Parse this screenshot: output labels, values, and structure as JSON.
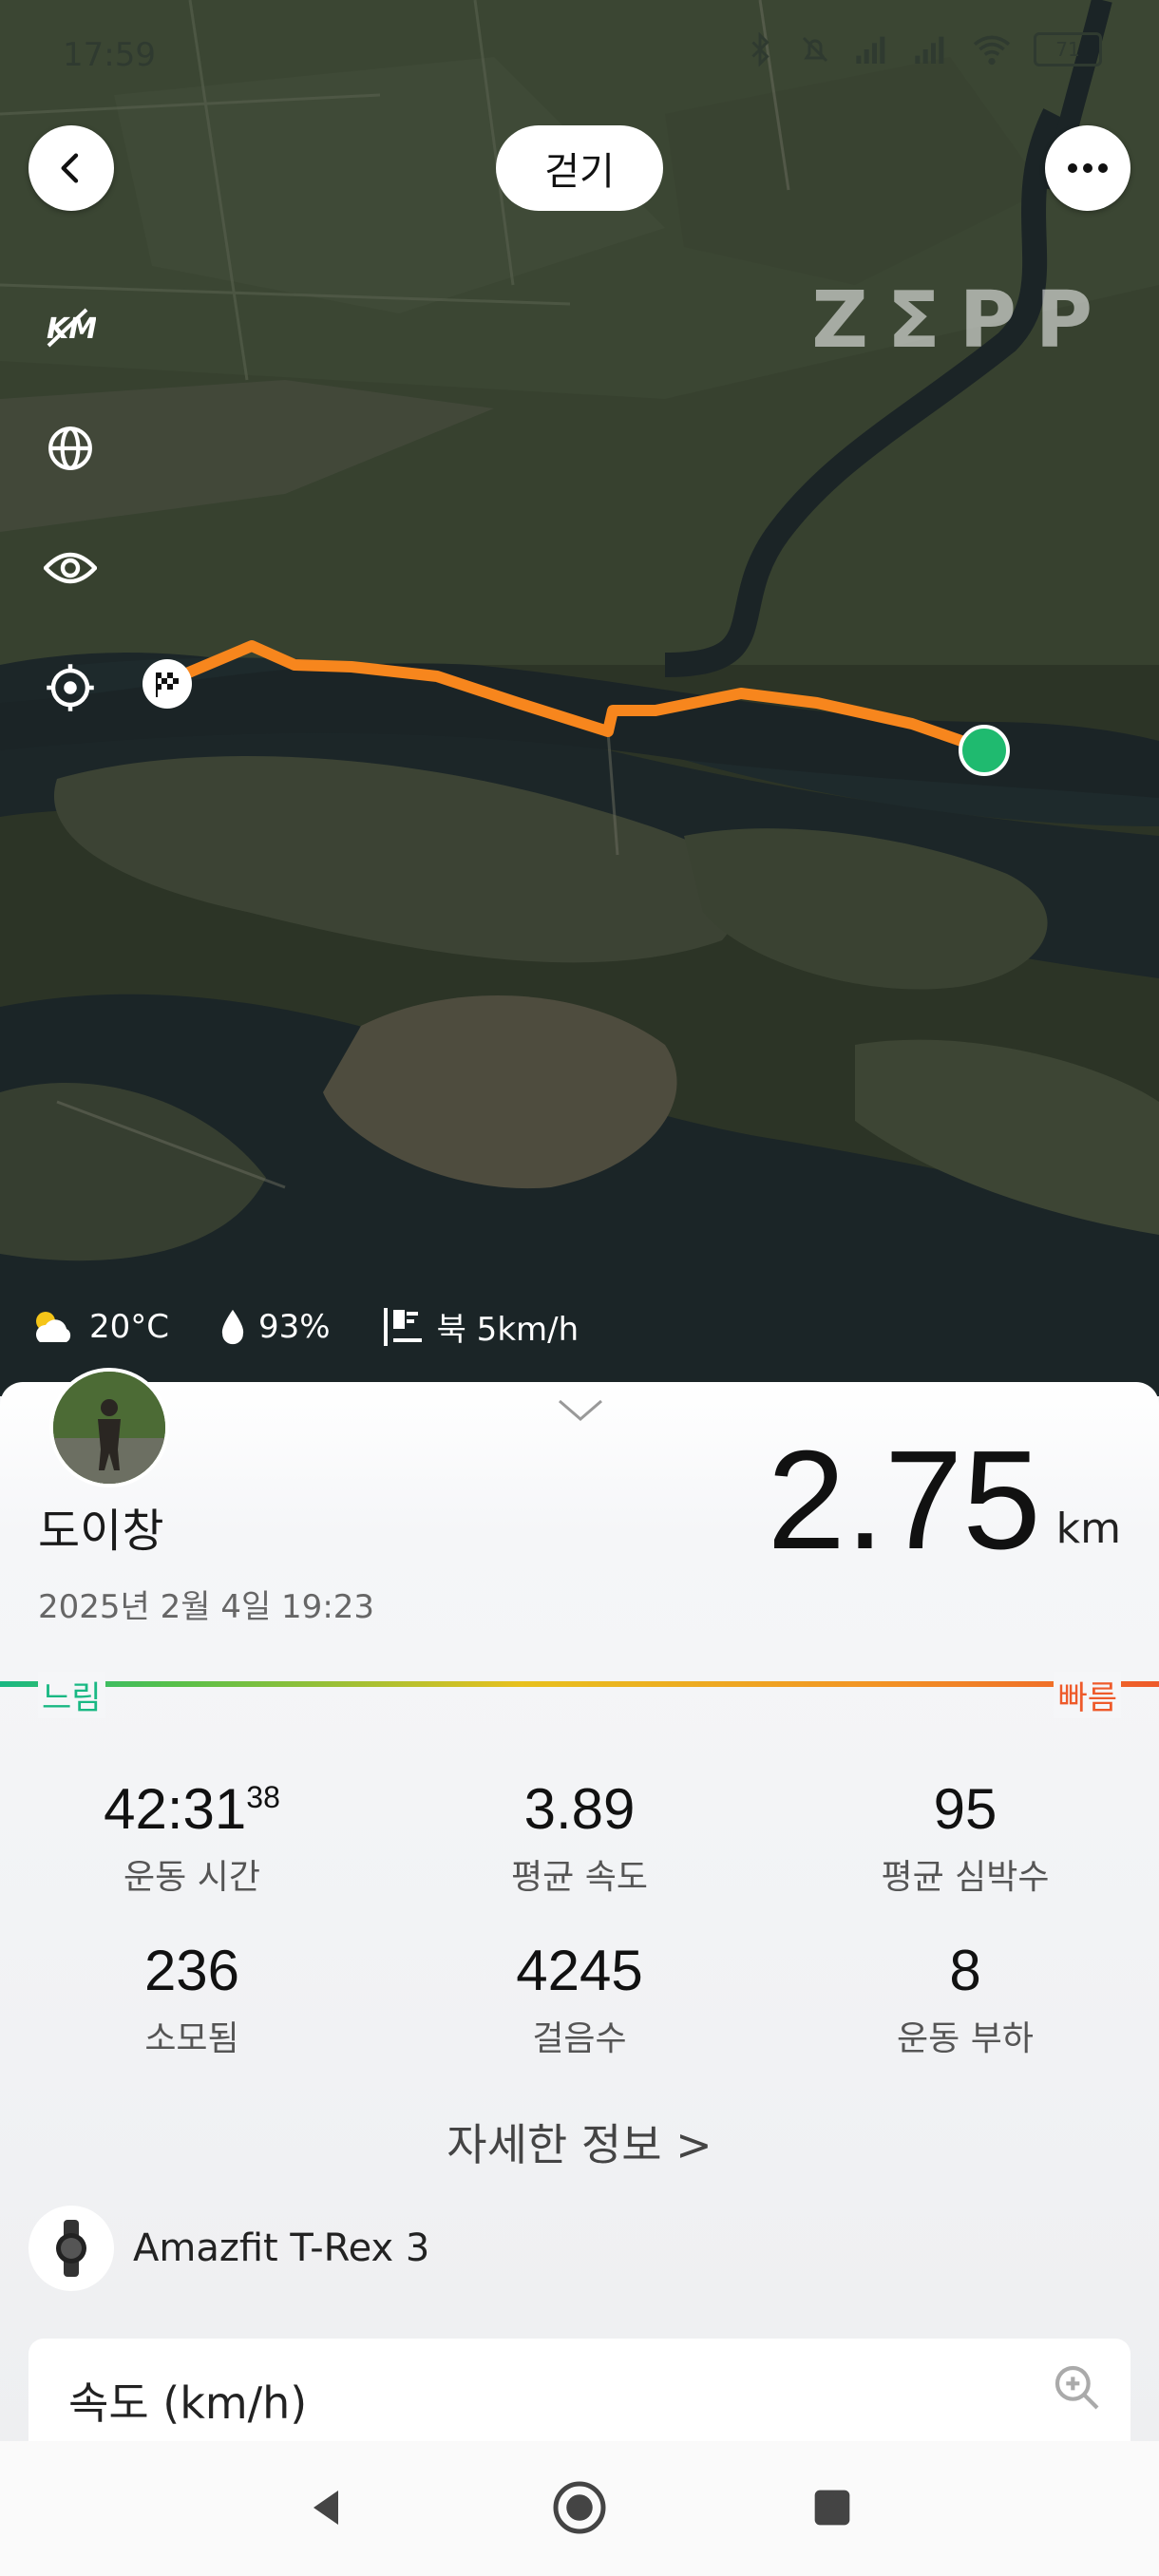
{
  "status_bar": {
    "time": "17:59",
    "battery": "71"
  },
  "header": {
    "mode": "걷기",
    "brand": "ZΣPP"
  },
  "map_tools": [
    {
      "name": "km-toggle-icon",
      "label": "km"
    },
    {
      "name": "globe-icon"
    },
    {
      "name": "eye-icon"
    },
    {
      "name": "locate-icon"
    }
  ],
  "weather": {
    "temperature": "20°C",
    "humidity": "93%",
    "wind": "북 5km/h"
  },
  "workout": {
    "user_name": "도이창",
    "date": "2025년 2월 4일 19:23",
    "distance": "2.75",
    "distance_unit": "km"
  },
  "pace_legend": {
    "slow": "느림",
    "fast": "빠름"
  },
  "stats": [
    {
      "value": "42:31",
      "sup": "38",
      "label": "운동 시간"
    },
    {
      "value": "3.89",
      "label": "평균 속도"
    },
    {
      "value": "95",
      "label": "평균 심박수"
    },
    {
      "value": "236",
      "label": "소모됨"
    },
    {
      "value": "4245",
      "label": "걸음수"
    },
    {
      "value": "8",
      "label": "운동 부하"
    }
  ],
  "more_info": "자세한 정보 >",
  "device": {
    "name": "Amazfit T-Rex 3"
  },
  "speed_card": {
    "title": "속도 (km/h)"
  },
  "colors": {
    "route": "#f7861d",
    "end_marker": "#1fba6f",
    "slow": "#19b883",
    "fast": "#ee5a2a"
  }
}
